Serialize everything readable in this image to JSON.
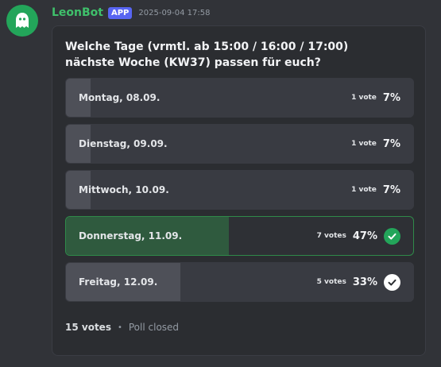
{
  "message": {
    "username": "LeonBot",
    "tag": "APP",
    "timestamp": "2025-09-04 17:58"
  },
  "poll": {
    "question": "Welche Tage (vrmtl. ab 15:00 / 16:00 / 17:00) nächste Woche (KW37) passen für euch?",
    "answers": [
      {
        "label": "Montag, 08.09.",
        "votes": "1 vote",
        "percent": "7%",
        "share": 0.07
      },
      {
        "label": "Dienstag, 09.09.",
        "votes": "1 vote",
        "percent": "7%",
        "share": 0.07
      },
      {
        "label": "Mittwoch, 10.09.",
        "votes": "1 vote",
        "percent": "7%",
        "share": 0.07
      },
      {
        "label": "Donnerstag, 11.09.",
        "votes": "7 votes",
        "percent": "47%",
        "share": 0.47,
        "winner": true,
        "checked": true
      },
      {
        "label": "Freitag, 12.09.",
        "votes": "5 votes",
        "percent": "33%",
        "share": 0.33,
        "checked": true
      }
    ],
    "total_votes": "15 votes",
    "separator": "•",
    "status": "Poll closed"
  },
  "colors": {
    "username": "#3fc06b",
    "app_tag": "#5865f2",
    "winner_border": "#2f8a49",
    "check_green": "#23a55a"
  }
}
